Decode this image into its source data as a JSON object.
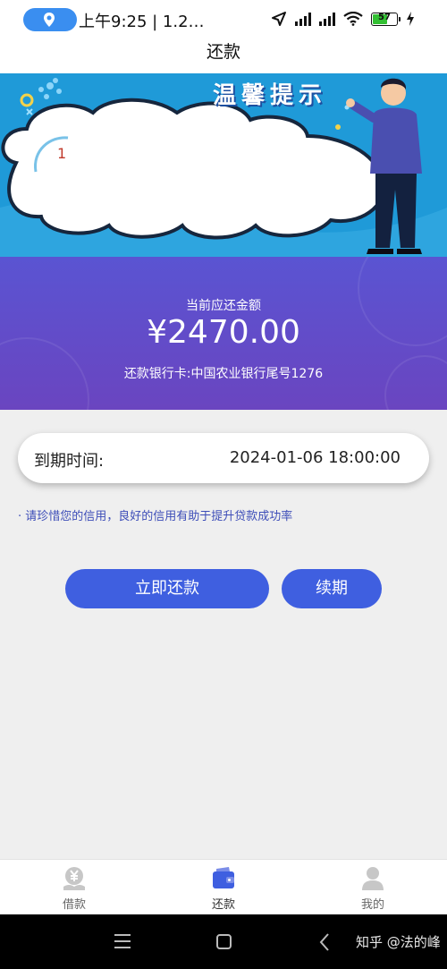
{
  "status": {
    "time": "上午9:25 | 1.2…",
    "battery": "57",
    "battery_level": 0.57,
    "icons": [
      "location-icon",
      "navigation-arrow-icon",
      "signal-icon",
      "hd-signal-icon",
      "wifi-icon",
      "battery-icon",
      "charging-icon"
    ]
  },
  "header": {
    "title": "还款"
  },
  "banner": {
    "title": "温馨提示",
    "note": "1"
  },
  "amount": {
    "label": "当前应还金额",
    "value": "¥2470.00",
    "bank": "还款银行卡:中国农业银行尾号1276"
  },
  "due": {
    "label": "到期时间:",
    "value": "2024-01-06 18:00:00"
  },
  "tip": "· 请珍惜您的信用，良好的信用有助于提升贷款成功率",
  "actions": {
    "pay_label": "立即还款",
    "renew_label": "续期"
  },
  "tabs": [
    {
      "label": "借款",
      "icon": "yen-coin-icon",
      "active": false
    },
    {
      "label": "还款",
      "icon": "wallet-icon",
      "active": true
    },
    {
      "label": "我的",
      "icon": "user-icon",
      "active": false
    }
  ],
  "watermark": "知乎 @法的峰",
  "colors": {
    "primary": "#3f5fe0",
    "amount_bg": "#5a54d2",
    "banner_bg": "#1f9ad8",
    "tip": "#3d4db8"
  }
}
